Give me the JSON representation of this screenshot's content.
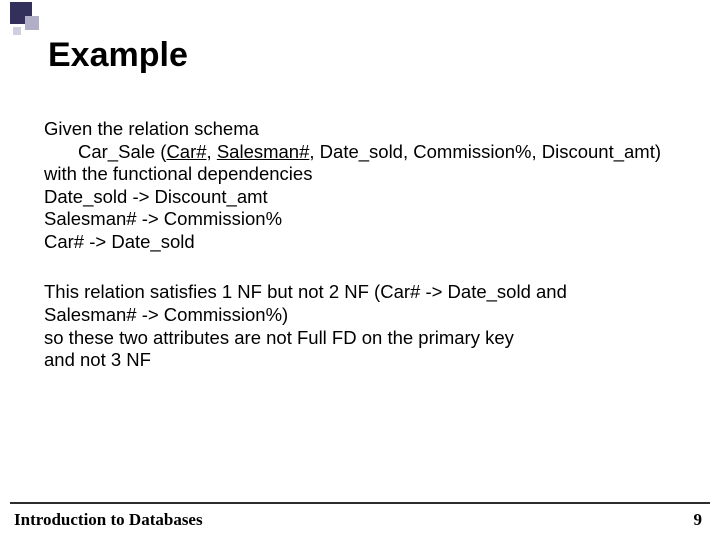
{
  "title": "Example",
  "body": {
    "given_line": "Given the relation schema",
    "schema_prefix": "Car_Sale (",
    "schema_key1": "Car#",
    "schema_sep1": ", ",
    "schema_key2": "Salesman#",
    "schema_rest": ", Date_sold, Commission%, Discount_amt)",
    "with_line": "with the functional dependencies",
    "fd1": "Date_sold -> Discount_amt",
    "fd2": "Salesman# -> Commission%",
    "fd3": "Car# -> Date_sold",
    "para2_l1": "This relation satisfies 1 NF but not 2 NF (Car# -> Date_sold and",
    "para2_l2": "Salesman# -> Commission%)",
    "para2_l3": "so these two attributes are not Full FD on the primary key",
    "para2_l4": "and not 3 NF"
  },
  "footer": {
    "left": "Introduction to Databases",
    "right": "9"
  }
}
